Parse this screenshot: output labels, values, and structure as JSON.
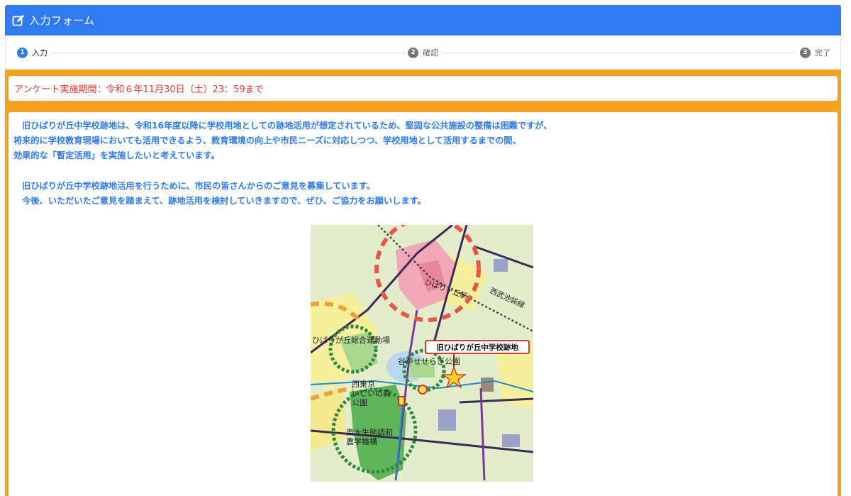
{
  "header": {
    "title": "入力フォーム",
    "icon": "edit-icon",
    "color": "#2f7bef"
  },
  "stepper": {
    "steps": [
      {
        "number": "1",
        "label": "入力",
        "state": "active"
      },
      {
        "number": "2",
        "label": "確認",
        "state": "idle"
      },
      {
        "number": "3",
        "label": "完了",
        "state": "idle"
      }
    ]
  },
  "notice": {
    "text": "アンケート実施期間：令和６年11月30日（土）23：59まで",
    "color": "#e53935"
  },
  "content": {
    "paragraph1": [
      "　旧ひばりが丘中学校跡地は、令和16年度以降に学校用地としての跡地活用が想定されているため、堅固な公共施設の整備は困難ですが、",
      "将来的に学校教育現場においても活用できるよう、教育環境の向上や市民ニーズに対応しつつ、学校用地として活用するまでの間、",
      "効果的な「暫定活用」を実施したいと考えています。"
    ],
    "paragraph2": [
      "　旧ひばりが丘中学校跡地活用を行うために、市民の皆さんからのご意見を募集しています。",
      "　今後、いただいたご意見を踏まえて、跡地活用を検討していきますので、ぜひ、ご協力をお願いします。"
    ],
    "text_color": "#2f7bef"
  },
  "map": {
    "labels": {
      "station": "ひばりヶ丘駅",
      "railway": "西武池袋線",
      "sports_ground": "ひばりが丘総合運動場",
      "callout": "旧ひばりが丘中学校跡地",
      "park1": "谷戸せせらぎ公園",
      "park2_line1": "西東京",
      "park2_line2": "いこいの森",
      "park2_line3": "公園",
      "univ_line1": "東大生態調和",
      "univ_line2": "農学機構"
    }
  },
  "frame_color": "#f5a21e"
}
